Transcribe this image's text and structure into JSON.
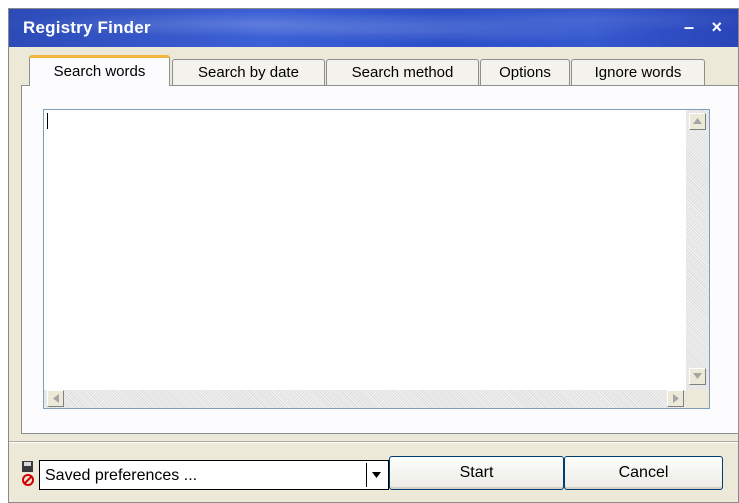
{
  "window": {
    "title": "Registry Finder",
    "min_glyph": "–",
    "close_glyph": "×"
  },
  "tabs": [
    {
      "label": "Search words",
      "active": true
    },
    {
      "label": "Search by date",
      "active": false
    },
    {
      "label": "Search method",
      "active": false
    },
    {
      "label": "Options",
      "active": false
    },
    {
      "label": "Ignore words",
      "active": false
    }
  ],
  "editor": {
    "value": ""
  },
  "footer": {
    "preferences": {
      "value": "Saved preferences ..."
    },
    "start_label": "Start",
    "cancel_label": "Cancel"
  },
  "colors": {
    "titlebar": "#3558cf",
    "active_tab_accent": "#f3b43c",
    "button_border": "#003c74"
  }
}
